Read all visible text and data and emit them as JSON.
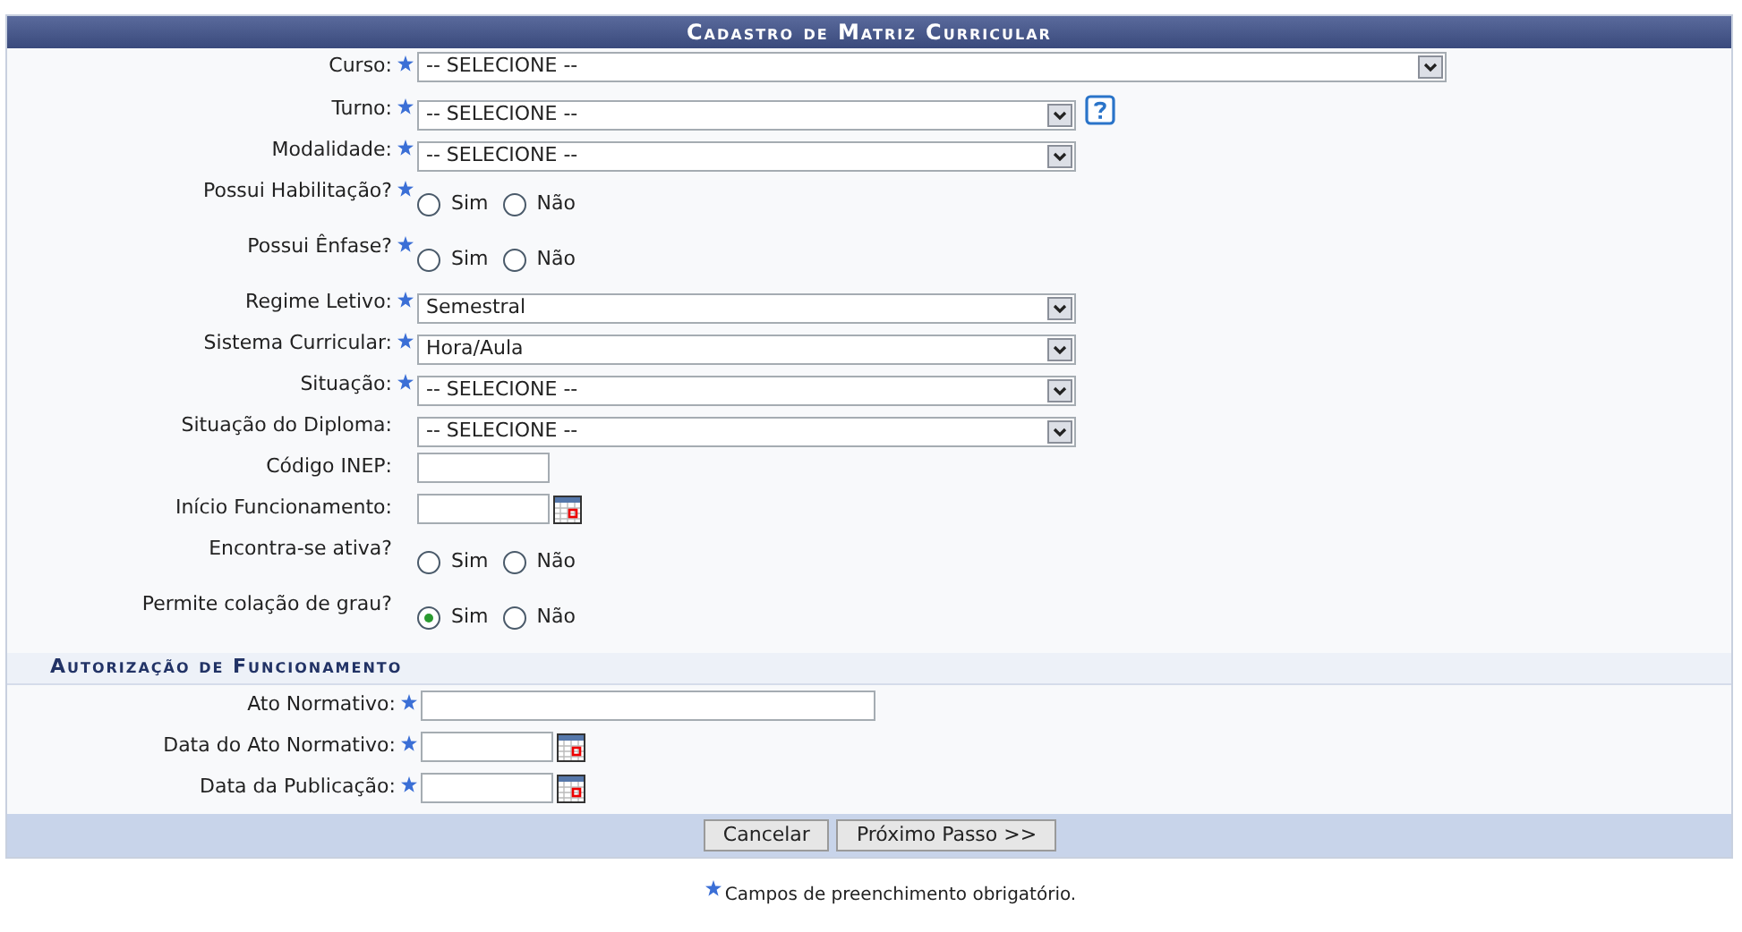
{
  "title": "Cadastro de Matriz Curricular",
  "fields": [
    {
      "kind": "wide-select",
      "label": "Curso:",
      "required": true,
      "value": "-- SELECIONE --"
    },
    {
      "kind": "select",
      "label": "Turno:",
      "required": true,
      "value": "-- SELECIONE --",
      "help": true
    },
    {
      "kind": "select",
      "label": "Modalidade:",
      "required": true,
      "value": "-- SELECIONE --"
    },
    {
      "kind": "radio",
      "label": "Possui Habilitação?",
      "required": true,
      "options": [
        {
          "label": "Sim",
          "selected": false
        },
        {
          "label": "Não",
          "selected": false
        }
      ]
    },
    {
      "kind": "radio",
      "label": "Possui Ênfase?",
      "required": true,
      "options": [
        {
          "label": "Sim",
          "selected": false
        },
        {
          "label": "Não",
          "selected": false
        }
      ]
    },
    {
      "kind": "select",
      "label": "Regime Letivo:",
      "required": true,
      "value": "Semestral"
    },
    {
      "kind": "select",
      "label": "Sistema Curricular:",
      "required": true,
      "value": "Hora/Aula"
    },
    {
      "kind": "select",
      "label": "Situação:",
      "required": true,
      "value": "-- SELECIONE --"
    },
    {
      "kind": "select",
      "label": "Situação do Diploma:",
      "required": false,
      "value": "-- SELECIONE --"
    },
    {
      "kind": "text",
      "label": "Código INEP:",
      "required": false
    },
    {
      "kind": "date",
      "label": "Início Funcionamento:",
      "required": false
    },
    {
      "kind": "radio",
      "label": "Encontra-se ativa?",
      "required": false,
      "options": [
        {
          "label": "Sim",
          "selected": false
        },
        {
          "label": "Não",
          "selected": false
        }
      ]
    },
    {
      "kind": "radio",
      "label": "Permite colação de grau?",
      "required": false,
      "options": [
        {
          "label": "Sim",
          "selected": true
        },
        {
          "label": "Não",
          "selected": false
        }
      ]
    }
  ],
  "section": {
    "title": "Autorização de Funcionamento",
    "fields": [
      {
        "kind": "long-text",
        "label": "Ato Normativo:",
        "required": true
      },
      {
        "kind": "date",
        "label": "Data do Ato Normativo:",
        "required": true
      },
      {
        "kind": "date",
        "label": "Data da Publicação:",
        "required": true
      }
    ]
  },
  "buttons": [
    "Cancelar",
    "Próximo Passo >>"
  ],
  "note": "Campos de preenchimento obrigatório."
}
